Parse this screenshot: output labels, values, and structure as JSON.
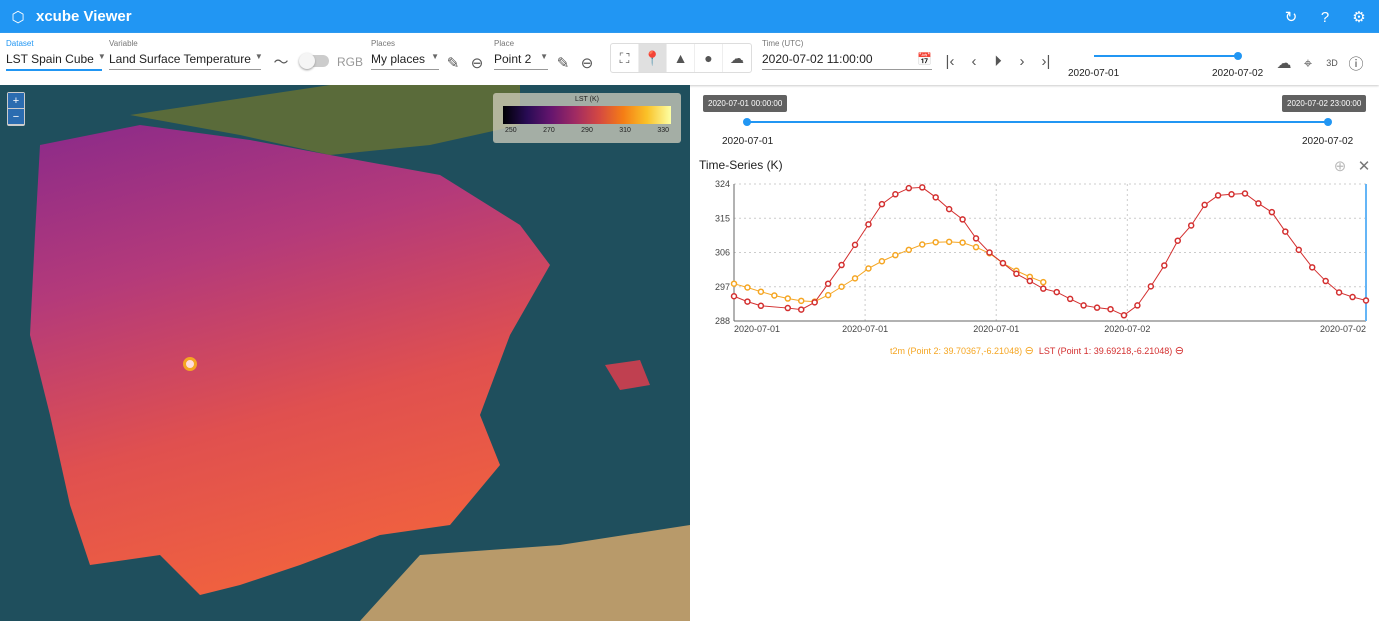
{
  "app": {
    "title": "xcube Viewer",
    "icons": [
      "cube-logo-icon",
      "refresh-icon",
      "help-icon",
      "settings-icon"
    ]
  },
  "toolbar": {
    "dataset": {
      "label": "Dataset",
      "value": "LST Spain Cube"
    },
    "variable": {
      "label": "Variable",
      "value": "Land Surface Temperature"
    },
    "rgb_label": "RGB",
    "rgb_on": false,
    "places": {
      "label": "Places",
      "value": "My places"
    },
    "place": {
      "label": "Place",
      "value": "Point 2"
    },
    "time": {
      "label": "Time (UTC)",
      "value": "2020-07-02 11:00:00"
    },
    "slider": {
      "min_label": "2020-07-01",
      "max_label": "2020-07-02",
      "value_fraction": 1.0
    }
  },
  "map": {
    "colorbar": {
      "title": "LST (K)",
      "ticks": [
        "250",
        "270",
        "290",
        "310",
        "330"
      ]
    },
    "zoom_in": "+",
    "zoom_out": "−"
  },
  "range": {
    "start_tooltip": "2020-07-01 00:00:00",
    "end_tooltip": "2020-07-02 23:00:00",
    "start_label": "2020-07-01",
    "end_label": "2020-07-02"
  },
  "chart_data": {
    "type": "line",
    "title": "Time-Series (K)",
    "ylim": [
      288,
      324
    ],
    "yticks": [
      288,
      297,
      306,
      315,
      324
    ],
    "xticks": [
      {
        "at": "2020-07-01T00:00",
        "label": "2020-07-01"
      },
      {
        "at": "2020-07-01T09:45",
        "label": "2020-07-01"
      },
      {
        "at": "2020-07-01T19:30",
        "label": "2020-07-01"
      },
      {
        "at": "2020-07-02T05:15",
        "label": "2020-07-02"
      },
      {
        "at": "2020-07-02T23:00",
        "label": "2020-07-02"
      }
    ],
    "x": [
      "2020-07-01T00",
      "2020-07-01T01",
      "2020-07-01T02",
      "2020-07-01T03",
      "2020-07-01T04",
      "2020-07-01T05",
      "2020-07-01T06",
      "2020-07-01T07",
      "2020-07-01T08",
      "2020-07-01T09",
      "2020-07-01T10",
      "2020-07-01T11",
      "2020-07-01T12",
      "2020-07-01T13",
      "2020-07-01T14",
      "2020-07-01T15",
      "2020-07-01T16",
      "2020-07-01T17",
      "2020-07-01T18",
      "2020-07-01T19",
      "2020-07-01T20",
      "2020-07-01T21",
      "2020-07-01T22",
      "2020-07-01T23",
      "2020-07-02T00",
      "2020-07-02T01",
      "2020-07-02T02",
      "2020-07-02T03",
      "2020-07-02T04",
      "2020-07-02T05",
      "2020-07-02T06",
      "2020-07-02T07",
      "2020-07-02T08",
      "2020-07-02T09",
      "2020-07-02T10",
      "2020-07-02T11",
      "2020-07-02T12",
      "2020-07-02T13",
      "2020-07-02T14",
      "2020-07-02T15",
      "2020-07-02T16",
      "2020-07-02T17",
      "2020-07-02T18",
      "2020-07-02T19",
      "2020-07-02T20",
      "2020-07-02T21",
      "2020-07-02T22",
      "2020-07-02T23"
    ],
    "grid": true,
    "legend": "bottom",
    "selected_time": "2020-07-02T23",
    "series": [
      {
        "name": "t2m (Point 2: 39.70367,-6.21048)",
        "color": "#f5a623",
        "values": [
          297.8,
          296.8,
          295.7,
          294.7,
          293.9,
          293.3,
          293.1,
          294.8,
          297.0,
          299.2,
          301.8,
          303.7,
          305.3,
          306.7,
          308.1,
          308.7,
          308.8,
          308.6,
          307.4,
          305.8,
          303.2,
          301.2,
          299.6,
          298.2
        ]
      },
      {
        "name": "LST (Point 1: 39.69218,-6.21048)",
        "color": "#d32f2f",
        "values": [
          294.5,
          293.1,
          292.0,
          null,
          291.4,
          291.0,
          292.9,
          297.8,
          302.7,
          308.0,
          313.4,
          318.7,
          321.3,
          322.9,
          323.1,
          320.5,
          317.4,
          314.7,
          309.7,
          306.0,
          303.2,
          300.4,
          298.5,
          296.5,
          295.6,
          293.8,
          292.1,
          291.5,
          291.1,
          289.5,
          292.1,
          297.1,
          302.6,
          309.1,
          313.1,
          318.5,
          321.0,
          321.3,
          321.5,
          318.9,
          316.6,
          311.5,
          306.7,
          302.1,
          298.5,
          295.5,
          294.3,
          293.4
        ]
      }
    ]
  }
}
